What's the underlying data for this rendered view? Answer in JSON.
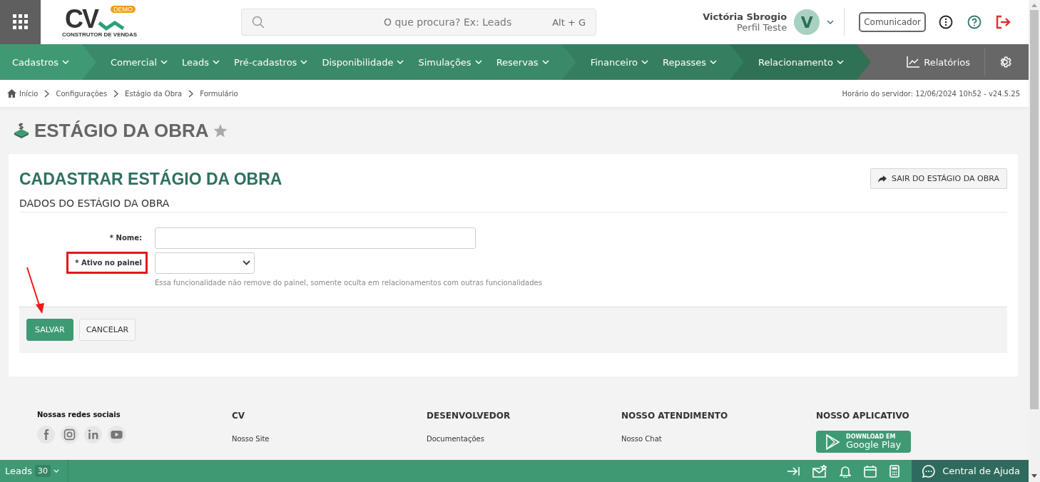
{
  "header": {
    "logo": {
      "mark": "CV",
      "badge": "DEMO",
      "tagline": "CONSTRUTOR DE VENDAS"
    },
    "search": {
      "placeholder": "O que procura? Ex: Leads",
      "shortcut": "Alt + G"
    },
    "user": {
      "name": "Victória Sbrogio",
      "role": "Perfil Teste",
      "initial": "V"
    },
    "communicator_button": "Comunicador"
  },
  "nav": {
    "groups": [
      {
        "color": "#3f9a74",
        "items": [
          "Cadastros"
        ]
      },
      {
        "color": "#3a8a69",
        "items": [
          "Comercial",
          "Leads",
          "Pré-cadastros",
          "Disponibilidade",
          "Simulações",
          "Reservas"
        ]
      },
      {
        "color": "#357f60",
        "items": [
          "Financeiro",
          "Repasses"
        ]
      },
      {
        "color": "#2f7155",
        "items": [
          "Relacionamento"
        ]
      }
    ],
    "reports": "Relatórios"
  },
  "breadcrumb": {
    "items": [
      "Início",
      "Configurações",
      "Estágio da Obra",
      "Formulário"
    ],
    "server_time": "Horário do servidor: 12/06/2024 10h52 - v24.5.25"
  },
  "page": {
    "title": "ESTÁGIO DA OBRA",
    "favorite": false
  },
  "card": {
    "title": "CADASTRAR ESTÁGIO DA OBRA",
    "exit_button": "SAIR DO ESTÁGIO DA OBRA",
    "section": "DADOS DO ESTÁGIO DA OBRA",
    "fields": [
      {
        "kind": "text",
        "label": "* Nome:",
        "highlighted": false
      },
      {
        "kind": "select",
        "label": "* Ativo no painel",
        "highlighted": true,
        "hint": "Essa funcionalidade não remove do painel, somente oculta em relacionamentos com outras funcionalidades"
      }
    ],
    "buttons": [
      {
        "label": "SALVAR",
        "primary": true,
        "pointed": true
      },
      {
        "label": "CANCELAR",
        "primary": false,
        "pointed": false
      }
    ]
  },
  "footer": {
    "social_title": "Nossas redes sociais",
    "columns": [
      {
        "title": "CV",
        "links": [
          "Nosso Site"
        ]
      },
      {
        "title": "DESENVOLVEDOR",
        "links": [
          "Documentações"
        ]
      },
      {
        "title": "NOSSO ATENDIMENTO",
        "links": [
          "Nosso Chat"
        ]
      }
    ],
    "app": {
      "title": "NOSSO APLICATIVO",
      "badge_small": "DOWNLOAD EM",
      "badge_big": "Google Play"
    }
  },
  "bottom_bar": {
    "leads_label": "Leads",
    "leads_count": "30",
    "help": "Central de Ajuda"
  }
}
